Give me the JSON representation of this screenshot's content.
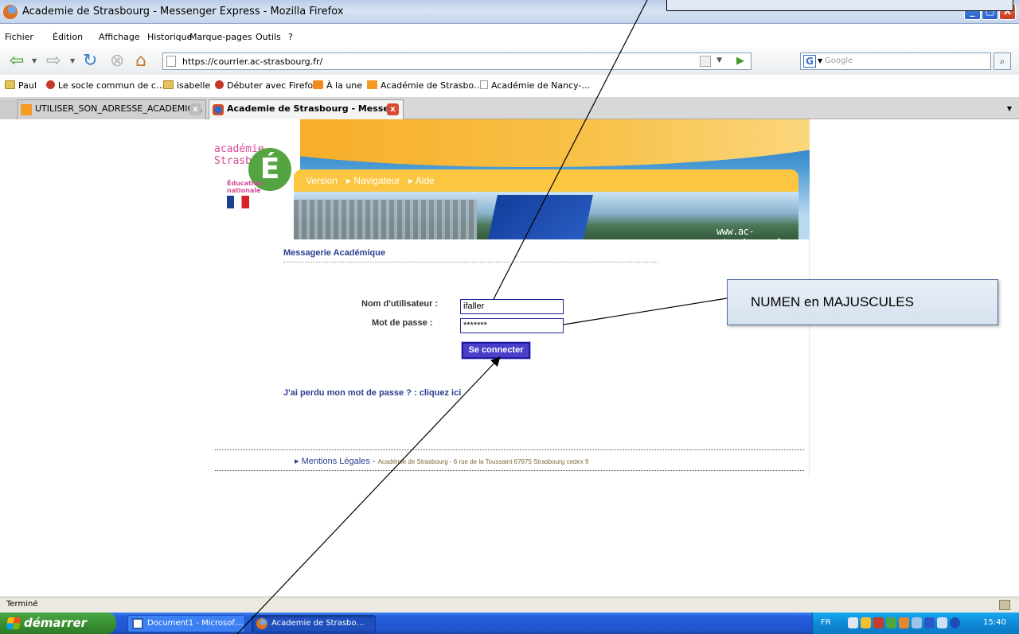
{
  "window": {
    "title": "Academie de Strasbourg - Messenger Express - Mozilla Firefox",
    "minimize": "_",
    "maximize": "□",
    "close": "X"
  },
  "menu": [
    "Fichier",
    "Édition",
    "Affichage",
    "Historique",
    "Marque-pages",
    "Outils",
    "?"
  ],
  "nav": {
    "url": "https://courrier.ac-strasbourg.fr/",
    "search_placeholder": "Google",
    "search_engine": "G"
  },
  "bookmarks": [
    {
      "label": "Paul",
      "icon": "folder-icon"
    },
    {
      "label": "Le socle commun de c…",
      "icon": "red-icon"
    },
    {
      "label": "isabelle",
      "icon": "folder-icon"
    },
    {
      "label": "Débuter avec Firefox",
      "icon": "firefox-icon"
    },
    {
      "label": "À la une",
      "icon": "rss-icon"
    },
    {
      "label": "Académie de Strasbo…",
      "icon": "orange-icon"
    },
    {
      "label": "Académie de Nancy-…",
      "icon": "page-icon"
    }
  ],
  "tabs": [
    {
      "label": "UTILISER_SON_ADRESSE_ACADEMIQ…",
      "active": false
    },
    {
      "label": "Academie de Strasbourg - Messe…",
      "active": true
    }
  ],
  "banner": {
    "logo_line1": "académie",
    "logo_line2": "Strasbourg",
    "logo_letter": "É",
    "ed_nat_1": "Éducation",
    "ed_nat_2": "nationale",
    "links": [
      "Version",
      "▸ Navigateur",
      "▸ Aide"
    ],
    "site_url": "www.ac-strasbourg.fr"
  },
  "login": {
    "heading": "Messagerie Académique",
    "username_label": "Nom d'utilisateur :",
    "username_value": "ifaller",
    "password_label": "Mot de passe :",
    "password_value": "*******",
    "submit_label": "Se connecter",
    "lost_text": "J'ai perdu mon mot de passe ? :",
    "lost_link": "cliquez ici"
  },
  "footer": {
    "link": "▸ Mentions Légales",
    "sep": " - ",
    "address": "Académie de Strasbourg - 6 rue de la Toussaint 67975 Strasbourg cedex 9"
  },
  "status": {
    "text": "Terminé"
  },
  "taskbar": {
    "start": "démarrer",
    "tasks": [
      "Document1 - Microsof…",
      "Academie de Strasbo…"
    ],
    "lang": "FR",
    "clock": "15:40"
  },
  "annotations": {
    "numen": "NUMEN en MAJUSCULES"
  },
  "colors": {
    "link_blue": "#2a3f8f",
    "submit_bg": "#4a3fc9",
    "banner_yellow": "#fcc640",
    "xp_taskbar": "#245edb",
    "start_green": "#3a9133"
  }
}
